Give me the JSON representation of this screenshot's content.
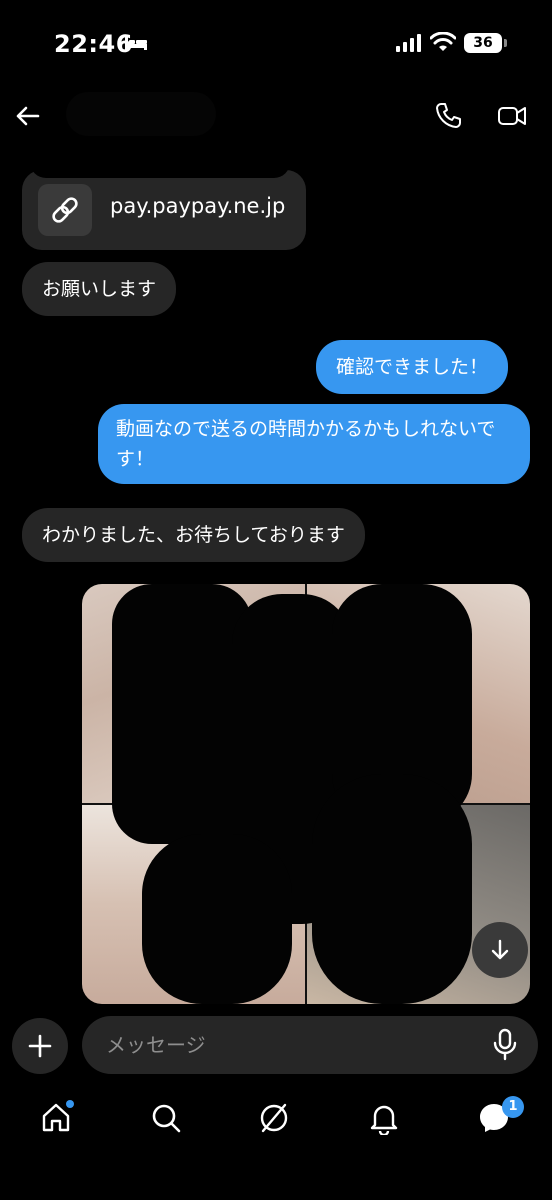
{
  "status_bar": {
    "time": "22:46",
    "battery": "36"
  },
  "messages": {
    "link_card": {
      "text": "pay.paypay.ne.jp"
    },
    "incoming_1": "お願いします",
    "outgoing_1": "確認できました！",
    "outgoing_2": "動画なので送るの時間かかるかもしれないです！",
    "incoming_2": "わかりました、お待ちしております"
  },
  "composer": {
    "placeholder": "メッセージ"
  },
  "nav": {
    "messages_badge": "1"
  },
  "colors": {
    "background": "#000000",
    "incoming_bubble": "#262626",
    "outgoing_bubble": "#3797f0"
  },
  "icons": [
    "bed-icon",
    "signal-icon",
    "wifi-icon",
    "back-arrow-icon",
    "phone-icon",
    "video-call-icon",
    "link-icon",
    "arrow-down-icon",
    "plus-icon",
    "mic-icon",
    "home-icon",
    "search-icon",
    "explore-icon",
    "heart-icon",
    "messenger-icon"
  ]
}
